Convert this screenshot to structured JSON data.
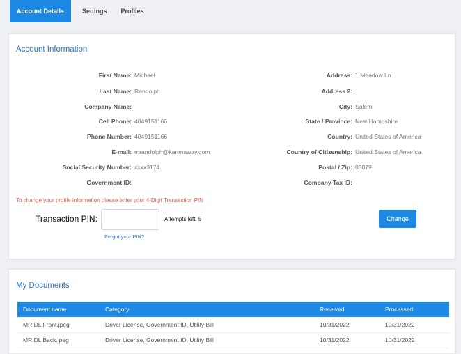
{
  "tabs": [
    "Account Details",
    "Settings",
    "Profiles"
  ],
  "account": {
    "title": "Account Information",
    "left": [
      {
        "label": "First Name:",
        "value": "Michael"
      },
      {
        "label": "Last Name:",
        "value": "Randolph"
      },
      {
        "label": "Company Name:",
        "value": ""
      },
      {
        "label": "Cell Phone:",
        "value": "4049151166"
      },
      {
        "label": "Phone Number:",
        "value": "4049151166"
      },
      {
        "label": "E-mail:",
        "value": "mrandolph@kanmaway.com"
      },
      {
        "label": "Social Security Number:",
        "value": "xxxx3174"
      },
      {
        "label": "Government ID:",
        "value": ""
      }
    ],
    "right": [
      {
        "label": "Address:",
        "value": "1 Meadow Ln"
      },
      {
        "label": "Address 2:",
        "value": ""
      },
      {
        "label": "City:",
        "value": "Salem"
      },
      {
        "label": "State / Province:",
        "value": "New Hampshire"
      },
      {
        "label": "Country:",
        "value": "United States of America"
      },
      {
        "label": "Country of Citizenship:",
        "value": "United States of America"
      },
      {
        "label": "Postal / Zip:",
        "value": "03079"
      },
      {
        "label": "Company Tax ID:",
        "value": ""
      }
    ],
    "notice": "To change your profile information please enter your 4-Digit Transaction PIN",
    "pin_label": "Transaction PIN:",
    "pin_value": "",
    "attempts": "Attempts left: 5",
    "forgot": "Forgot your PIN?",
    "change_button": "Change"
  },
  "docs": {
    "title": "My Documents",
    "columns": [
      "Document name",
      "Category",
      "Received",
      "Processed"
    ],
    "rows": [
      [
        "MR DL Front.jpeg",
        "Driver License, Government ID, Utility Bill",
        "10/31/2022",
        "10/31/2022"
      ],
      [
        "MR DL Back.jpeg",
        "Driver License, Government ID, Utility Bill",
        "10/31/2022",
        "10/31/2022"
      ]
    ]
  }
}
